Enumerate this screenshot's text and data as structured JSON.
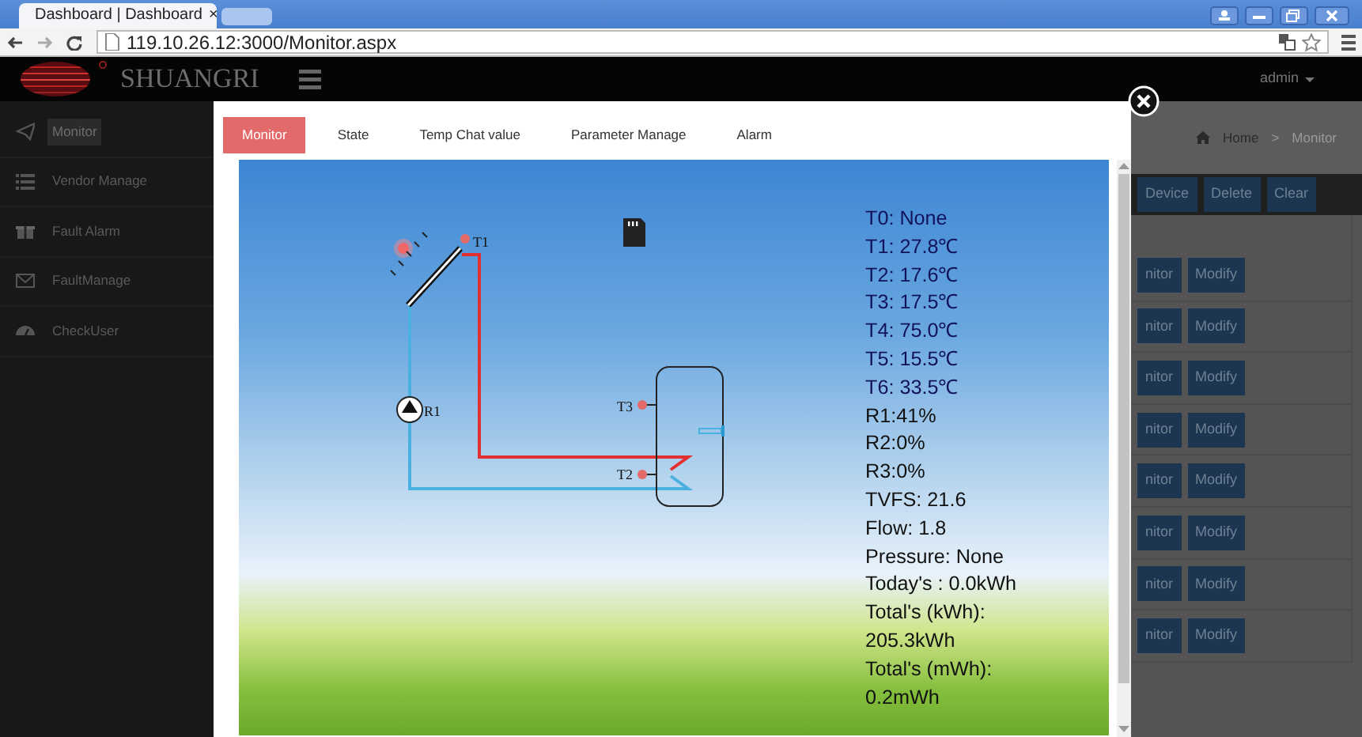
{
  "browser": {
    "tab_title": "Dashboard | Dashboard",
    "tab_close": "×",
    "url": "119.10.26.12:3000/Monitor.aspx"
  },
  "navbar": {
    "brand": "SHUANGRI",
    "user": "admin"
  },
  "sidebar": {
    "items": [
      {
        "label": "Monitor",
        "selected": true
      },
      {
        "label": "Vendor Manage",
        "selected": false
      },
      {
        "label": "Fault Alarm",
        "selected": false
      },
      {
        "label": "FaultManage",
        "selected": false
      },
      {
        "label": "CheckUser",
        "selected": false
      }
    ]
  },
  "page": {
    "breadcrumb": {
      "home": "Home",
      "separator": ">",
      "current": "Monitor"
    },
    "toolbar": [
      "Device",
      "Delete",
      "Clear"
    ],
    "rows": [
      {
        "actions": [
          "nitor",
          "Modify"
        ]
      },
      {
        "actions": [
          "nitor",
          "Modify"
        ]
      },
      {
        "actions": [
          "nitor",
          "Modify"
        ]
      },
      {
        "actions": [
          "nitor",
          "Modify"
        ]
      },
      {
        "actions": [
          "nitor",
          "Modify"
        ]
      },
      {
        "actions": [
          "nitor",
          "Modify"
        ]
      },
      {
        "actions": [
          "nitor",
          "Modify"
        ]
      },
      {
        "actions": [
          "nitor",
          "Modify"
        ]
      }
    ]
  },
  "modal": {
    "tabs": [
      {
        "label": "Monitor",
        "selected": true
      },
      {
        "label": "State",
        "selected": false
      },
      {
        "label": "Temp Chat value",
        "selected": false
      },
      {
        "label": "Parameter Manage",
        "selected": false
      },
      {
        "label": "Alarm",
        "selected": false
      }
    ],
    "diagram": {
      "collector_sensor": "T1",
      "pump": "R1",
      "tank_upper_sensor": "T3",
      "tank_lower_sensor": "T2"
    },
    "readings": [
      "T0: None",
      "T1: 27.8℃",
      "T2: 17.6℃",
      "T3: 17.5℃",
      "T4: 75.0℃",
      "T5: 15.5℃",
      "T6: 33.5℃",
      "R1:41%",
      "R2:0%",
      "R3:0%",
      "TVFS: 21.6",
      "Flow: 1.8",
      "Pressure: None",
      "Today's : 0.0kWh",
      "Total's (kWh):",
      "205.3kWh",
      "Total's (mWh):",
      "0.2mWh"
    ]
  }
}
